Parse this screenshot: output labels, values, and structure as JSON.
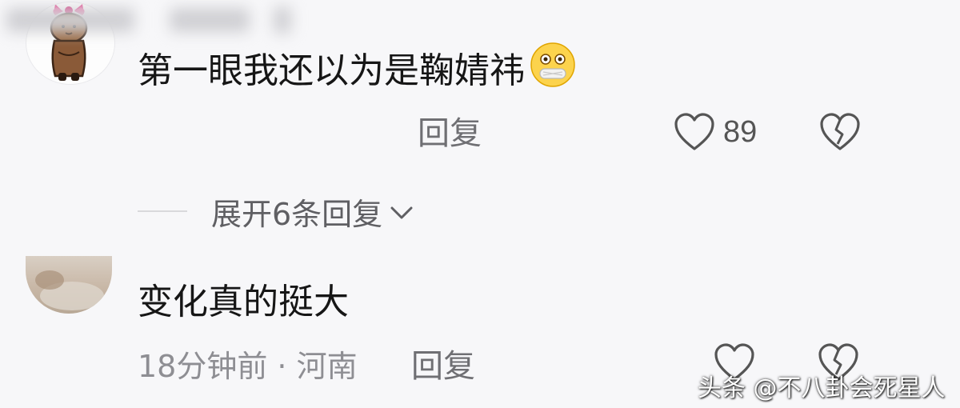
{
  "comments": [
    {
      "text": "第一眼我还以为是鞠婧祎",
      "emoji": "face-with-hand-over-mouth-emoji",
      "reply_label": "回复",
      "like_count": "89",
      "expand_label": "展开6条回复"
    },
    {
      "text": "变化真的挺大",
      "meta": "18分钟前 · 河南",
      "reply_label": "回复"
    }
  ],
  "watermark": "头条 @不八卦会死星人",
  "colors": {
    "background": "#f7f7f9",
    "text": "#161616",
    "meta_text": "#8e8e93",
    "icon_stroke": "#555555"
  }
}
